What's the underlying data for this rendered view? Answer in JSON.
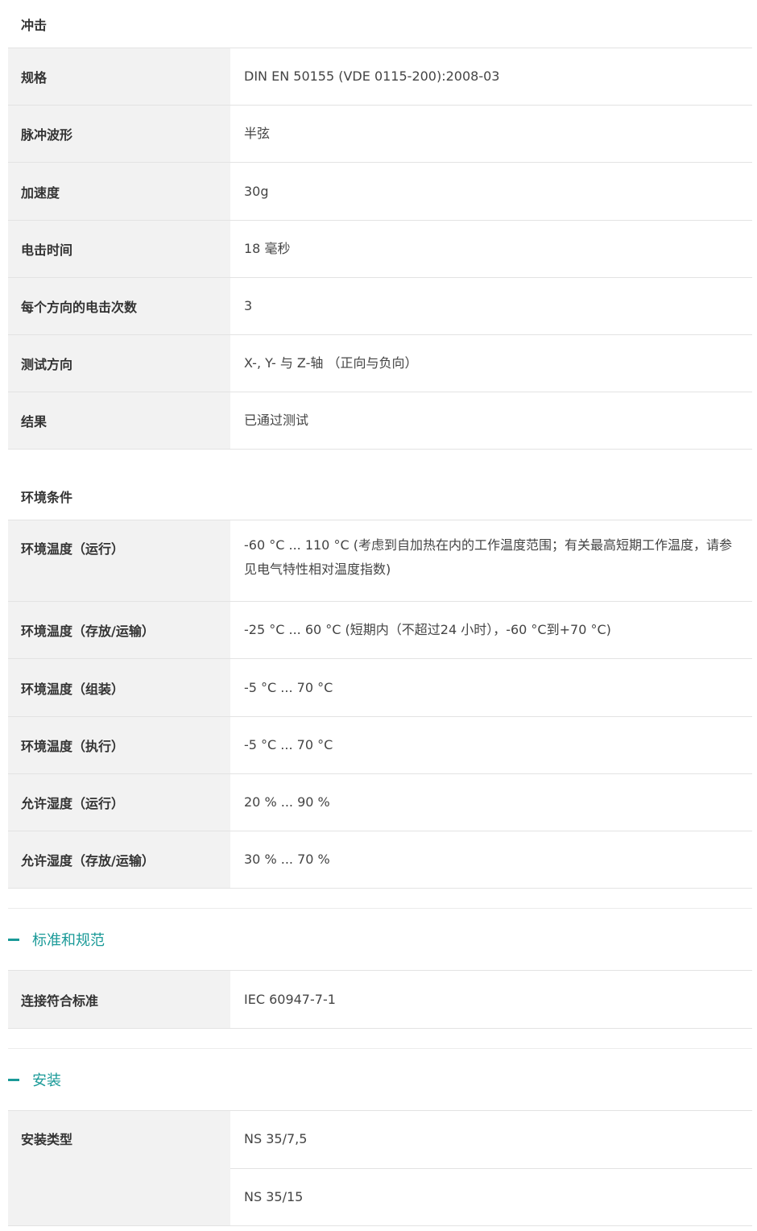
{
  "shock": {
    "title": "冲击",
    "rows": [
      {
        "label": "规格",
        "value": "DIN EN 50155 (VDE 0115-200):2008-03"
      },
      {
        "label": "脉冲波形",
        "value": "半弦"
      },
      {
        "label": "加速度",
        "value": "30g"
      },
      {
        "label": "电击时间",
        "value": "18 毫秒"
      },
      {
        "label": "每个方向的电击次数",
        "value": "3"
      },
      {
        "label": "测试方向",
        "value": "X-, Y- 与 Z-轴 （正向与负向）"
      },
      {
        "label": "结果",
        "value": "已通过测试"
      }
    ]
  },
  "environment": {
    "title": "环境条件",
    "rows": [
      {
        "label": "环境温度（运行）",
        "value": "-60 °C ... 110 °C (考虑到自加热在内的工作温度范围；有关最高短期工作温度，请参见电气特性相对温度指数)"
      },
      {
        "label": "环境温度（存放/运输）",
        "value": "-25 °C ... 60 °C (短期内（不超过24 小时），-60 °C到+70 °C)"
      },
      {
        "label": "环境温度（组装）",
        "value": "-5 °C ... 70 °C"
      },
      {
        "label": "环境温度（执行）",
        "value": "-5 °C ... 70 °C"
      },
      {
        "label": "允许湿度（运行）",
        "value": "20 % ... 90 %"
      },
      {
        "label": "允许湿度（存放/运输）",
        "value": "30 % ... 70 %"
      }
    ]
  },
  "standards": {
    "heading": "标准和规范",
    "icon": "minus-icon",
    "rows": [
      {
        "label": "连接符合标准",
        "value": "IEC 60947-7-1"
      }
    ]
  },
  "installation": {
    "heading": "安装",
    "icon": "minus-icon",
    "mount_label": "安装类型",
    "mount_values": [
      "NS 35/7,5",
      "NS 35/15"
    ]
  },
  "colors": {
    "accent": "#1a9a98",
    "label_bg": "#f2f2f2",
    "border": "#e3e3e3"
  }
}
